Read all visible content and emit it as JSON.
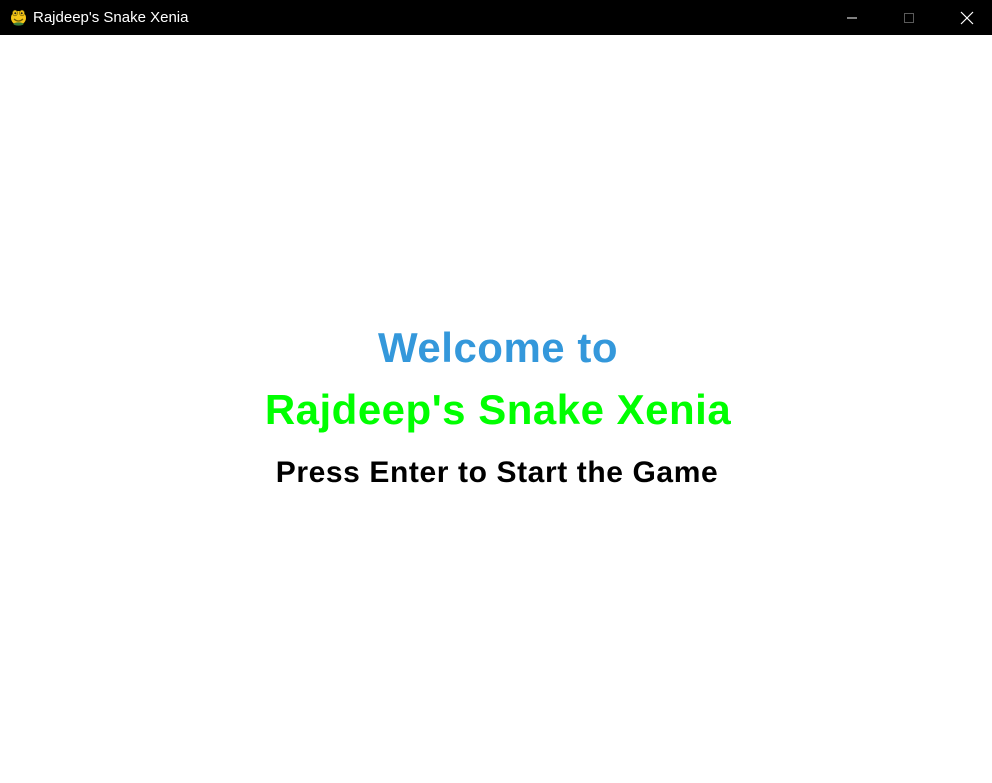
{
  "window": {
    "title": "Rajdeep's Snake Xenia",
    "app_icon": "pygame-snake-icon",
    "controls": {
      "minimize_icon": "minimize-icon",
      "maximize_icon": "maximize-icon",
      "close_icon": "close-icon"
    }
  },
  "screen": {
    "welcome_text": "Welcome to",
    "game_title": "Rajdeep's Snake Xenia",
    "start_prompt": "Press Enter to Start the Game"
  },
  "colors": {
    "titlebar_bg": "#000000",
    "canvas_bg": "#ffffff",
    "welcome": "#3498db",
    "game_title": "#00ff00",
    "prompt": "#000000"
  }
}
